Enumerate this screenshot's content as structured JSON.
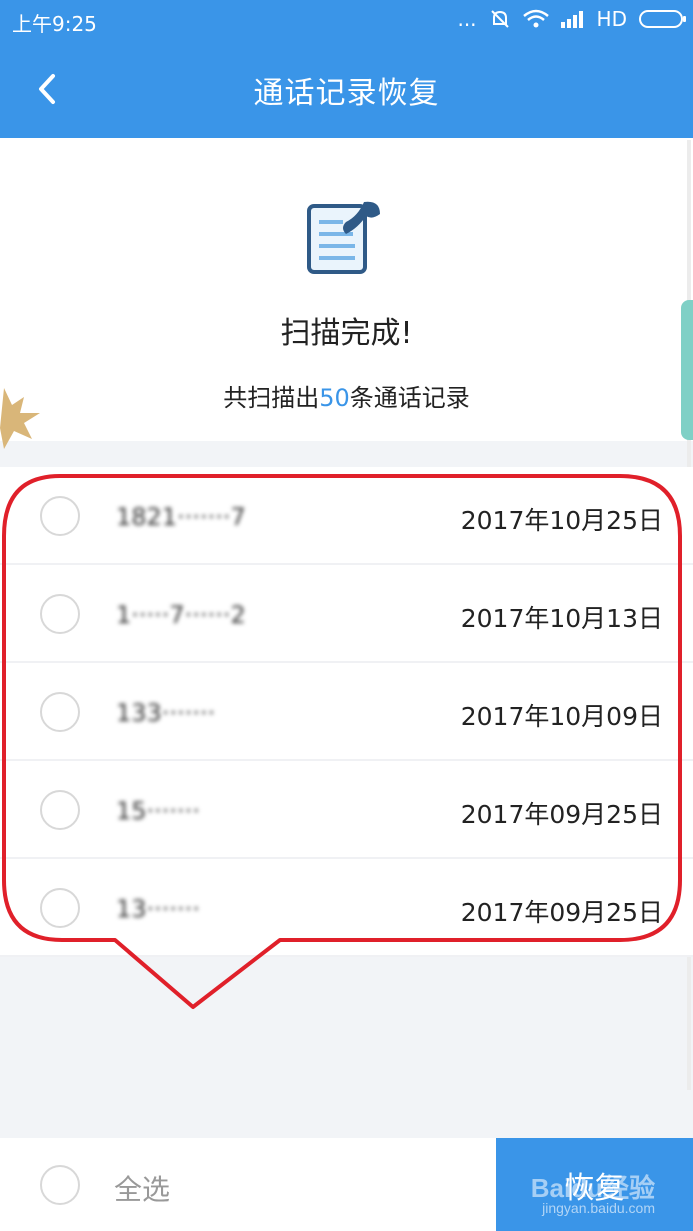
{
  "status_bar": {
    "time": "上午9:25",
    "dots": "...",
    "network": "HD"
  },
  "header": {
    "title": "通话记录恢复"
  },
  "summary": {
    "status": "扫描完成!",
    "count_prefix": "共扫描出",
    "count": "50",
    "count_suffix": "条通话记录"
  },
  "records": [
    {
      "phone": "1821·······7",
      "date": "2017年10月25日"
    },
    {
      "phone": "1·····7······2",
      "date": "2017年10月13日"
    },
    {
      "phone": "133·······",
      "date": "2017年10月09日"
    },
    {
      "phone": "15·······",
      "date": "2017年09月25日"
    },
    {
      "phone": "13·······",
      "date": "2017年09月25日"
    }
  ],
  "footer": {
    "select_all": "全选",
    "restore": "恢复",
    "watermark": "Baidu经验",
    "watermark_url": "jingyan.baidu.com"
  },
  "colors": {
    "accent": "#3a95e8",
    "highlight": "#e0202a"
  }
}
